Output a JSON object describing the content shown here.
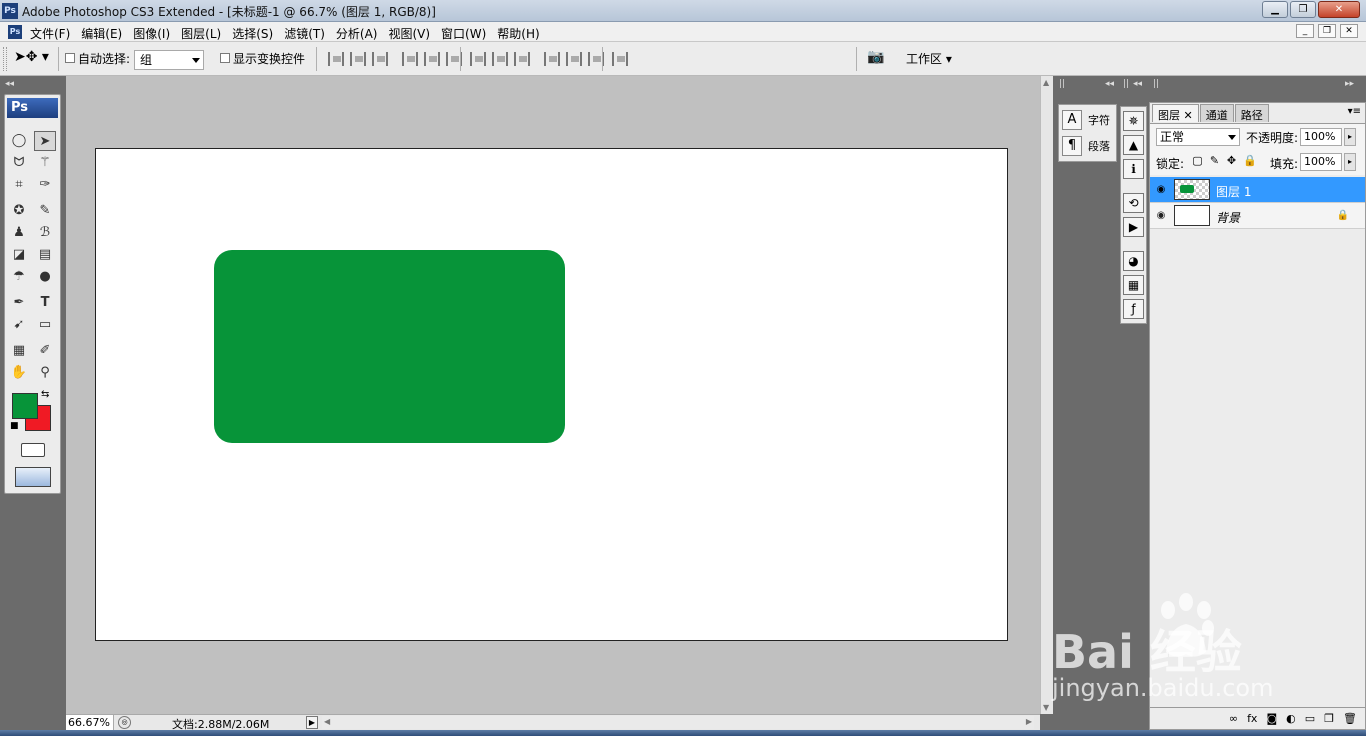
{
  "window": {
    "title": "Adobe Photoshop CS3 Extended - [未标题-1 @ 66.7% (图层 1, RGB/8)]",
    "logo": "Ps",
    "buttons": [
      "minimize",
      "maximize",
      "close"
    ]
  },
  "menubar": {
    "items": [
      "文件(F)",
      "编辑(E)",
      "图像(I)",
      "图层(L)",
      "选择(S)",
      "滤镜(T)",
      "分析(A)",
      "视图(V)",
      "窗口(W)",
      "帮助(H)"
    ]
  },
  "options": {
    "auto_select_label": "自动选择:",
    "auto_select_value": "组",
    "show_transform_label": "显示变换控件",
    "workspace_label": "工作区"
  },
  "toolbox": {
    "logo": "Ps",
    "foreground_color": "#079439",
    "background_color": "#f01a24",
    "tools": [
      "marquee",
      "move",
      "lasso",
      "magic-wand",
      "crop",
      "slice",
      "healing-brush",
      "brush",
      "clone-stamp",
      "history-brush",
      "eraser",
      "gradient",
      "blur",
      "dodge",
      "pen",
      "type",
      "path-selection",
      "shape",
      "notes",
      "eyedropper",
      "hand",
      "zoom"
    ]
  },
  "canvas": {
    "background": "#ffffff",
    "shape_color": "#079439"
  },
  "status": {
    "zoom": "66.67%",
    "doc_size": "文档:2.88M/2.06M"
  },
  "dock": {
    "char_panel": {
      "character": "字符",
      "paragraph": "段落"
    }
  },
  "layers_panel": {
    "tabs": [
      "图层",
      "通道",
      "路径"
    ],
    "blend_mode": "正常",
    "opacity_label": "不透明度:",
    "opacity_value": "100%",
    "lock_label": "锁定:",
    "fill_label": "填充:",
    "fill_value": "100%",
    "layers": [
      {
        "name": "图层 1",
        "selected": true
      },
      {
        "name": "背景",
        "selected": false,
        "locked": true
      }
    ],
    "selection_color": "#3399ff"
  },
  "watermark": {
    "logo": "Bai 经验",
    "url": "jingyan.baidu.com"
  }
}
